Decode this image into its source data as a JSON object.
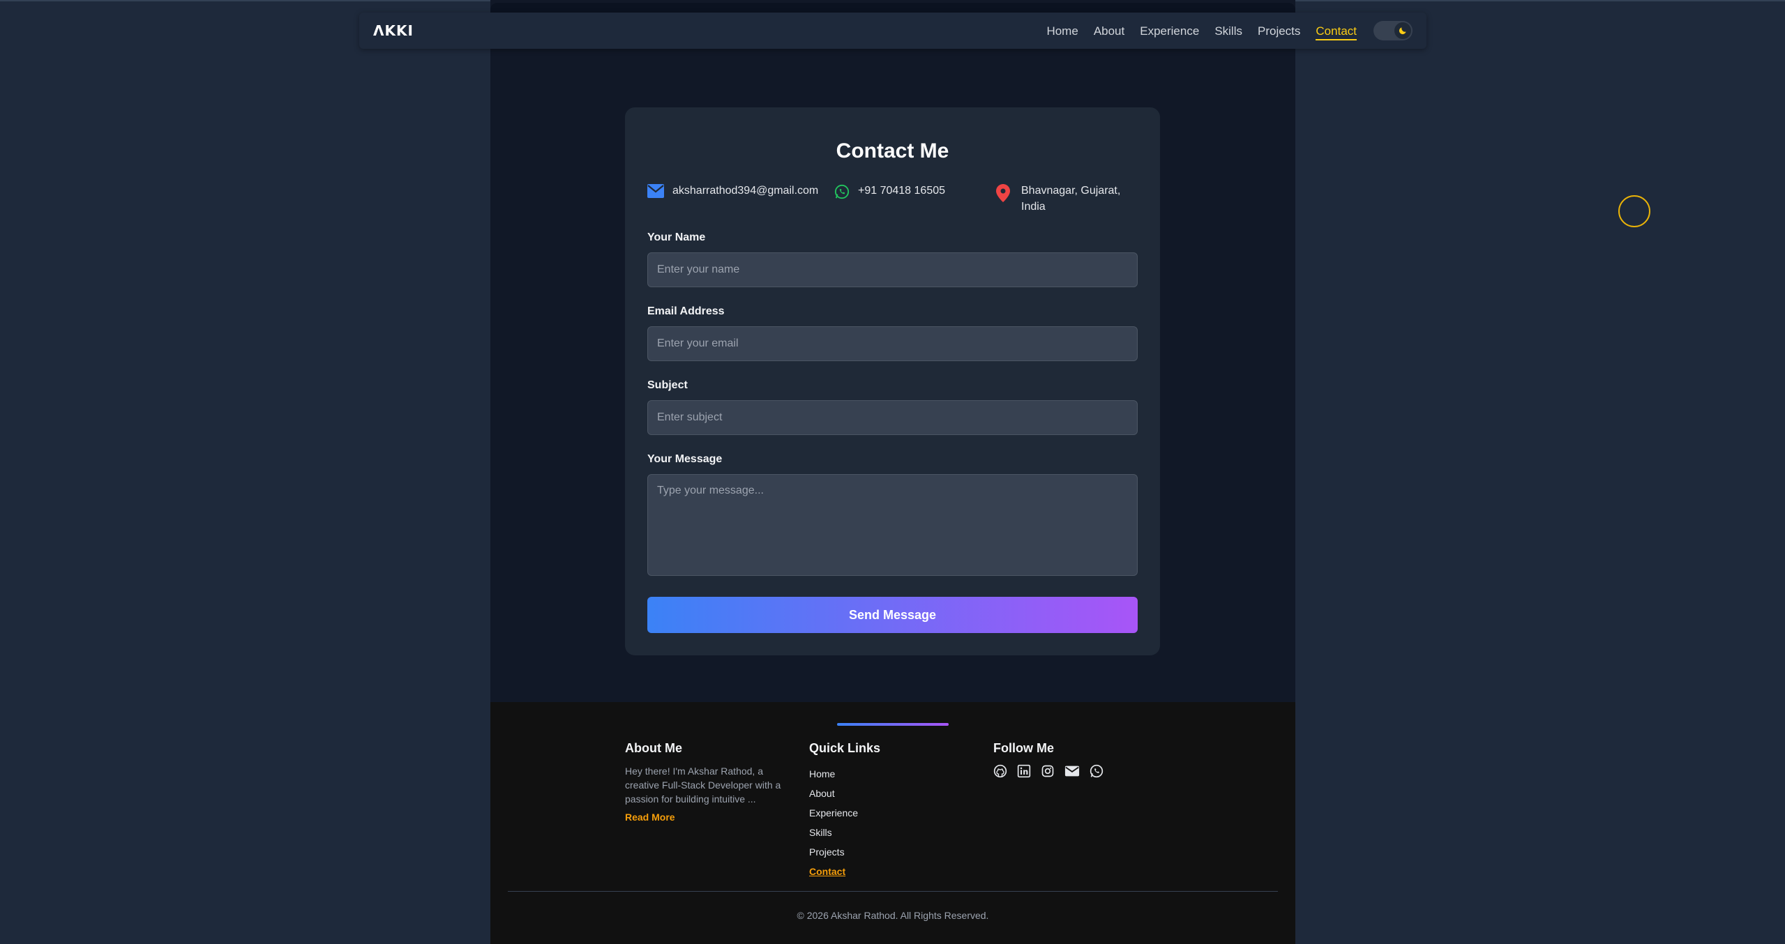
{
  "nav": {
    "logo": "ΛKKI",
    "links": [
      {
        "label": "Home"
      },
      {
        "label": "About"
      },
      {
        "label": "Experience"
      },
      {
        "label": "Skills"
      },
      {
        "label": "Projects"
      },
      {
        "label": "Contact",
        "active": true
      }
    ],
    "theme_toggle_icon": "moon-icon"
  },
  "contact": {
    "title": "Contact Me",
    "email": "aksharrathod394@gmail.com",
    "phone": "+91 70418 16505",
    "location_line1": "Bhavnagar, Gujarat,",
    "location_line2": "India",
    "fields": {
      "name_label": "Your Name",
      "name_placeholder": "Enter your name",
      "email_label": "Email Address",
      "email_placeholder": "Enter your email",
      "subject_label": "Subject",
      "subject_placeholder": "Enter subject",
      "message_label": "Your Message",
      "message_placeholder": "Type your message..."
    },
    "send_label": "Send Message"
  },
  "footer": {
    "about_heading": "About Me",
    "about_text": "Hey there! I'm Akshar Rathod, a creative Full-Stack Developer with a passion for building intuitive ...",
    "read_more": "Read More",
    "quick_heading": "Quick Links",
    "quick_links": [
      "Home",
      "About",
      "Experience",
      "Skills",
      "Projects",
      "Contact"
    ],
    "follow_heading": "Follow Me",
    "social_icons": [
      "github-icon",
      "linkedin-icon",
      "instagram-icon",
      "mail-icon",
      "whatsapp-icon"
    ],
    "copyright": "© 2026  Akshar Rathod. All Rights Reserved."
  },
  "colors": {
    "accent": "#facc15",
    "gradient_start": "#3b82f6",
    "gradient_end": "#a855f7",
    "email_icon": "#3b82f6",
    "phone_icon": "#22c55e",
    "location_icon": "#ef4444"
  }
}
